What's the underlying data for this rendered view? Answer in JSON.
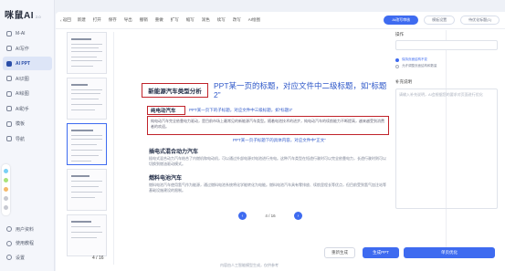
{
  "brand": {
    "name": "咪鼠AI",
    "version": "2.0"
  },
  "nav": [
    {
      "label": "M-AI",
      "icon": "chat-icon",
      "active": false
    },
    {
      "label": "AI写作",
      "icon": "pen-icon",
      "active": false
    },
    {
      "label": "AI PPT",
      "icon": "ppt-icon",
      "active": true
    },
    {
      "label": "AI识图",
      "icon": "image-icon",
      "active": false
    },
    {
      "label": "AI绘图",
      "icon": "brush-icon",
      "active": false
    },
    {
      "label": "AI助手",
      "icon": "assistant-icon",
      "active": false
    },
    {
      "label": "模板",
      "icon": "template-icon",
      "active": false
    },
    {
      "label": "导航",
      "icon": "compass-icon",
      "active": false
    }
  ],
  "side_bottom": [
    {
      "label": "用户资料",
      "icon": "user-icon"
    },
    {
      "label": "使用教程",
      "icon": "help-icon"
    },
    {
      "label": "设置",
      "icon": "settings-icon"
    }
  ],
  "toolbar": {
    "back": "返回",
    "items": [
      "新建",
      "打开",
      "保存",
      "导出",
      "撤销",
      "重做",
      "扩写",
      "缩写",
      "润色",
      "续写",
      "改写",
      "AI绘图"
    ],
    "pills": [
      "AI改写审核",
      "模板设置",
      "待优化标题(1)"
    ]
  },
  "slide": {
    "title": "新能源汽车类型分析",
    "title_note": "PPT某一页的标题，对应文件中二级标题，如“标题2”",
    "h2": "纯电动汽车",
    "h2_note": "PPT某一页下的子标题，对应文件中三级标题，如“标题3”",
    "para": "纯电动汽车完全依靠电力驱动，是目前市场上最常见的新能源汽车类型。随着电池技术的进步，纯电动汽车的续航能力不断提高，越来越受到消费者的欢迎。",
    "para_note": "PPT某一页子标题下的具体内容，对应文件中“正文”",
    "h3a": "插电式混合动力汽车",
    "body_a": "插电式混合动力汽车结合了内燃机和电动机，可以通过外部电源对电池进行充电。这种汽车类型在短途行驶时可以完全依靠电力，长途行驶时则可以切换到燃油驱动模式。",
    "h3b": "燃料电池汽车",
    "body_b": "燃料电池汽车使用氢气作为能源，通过燃料电池系统将化学能转化为电能。燃料电池汽车具有零排放、续航里程长等优点，但目前受到氢气加注站等基础设施建设的限制。"
  },
  "pager": {
    "label": "4 / 16",
    "prev": "‹",
    "next": "›"
  },
  "thumb_indicator": "4 / 16",
  "actions": {
    "regenerate": "重新生成",
    "generate": "生成PPT",
    "optimize": "单页优化"
  },
  "footer": "内容由人工智能模型生成，仅供参考",
  "right_panel": {
    "label_top": "操作",
    "radio_on": "保持页面结构不变",
    "radio_off": "允许调整页面结构和数量",
    "label_notes": "补充说明",
    "notes_placeholder": "请输入补充说明，AI会根据您的要求对页面进行优化"
  }
}
